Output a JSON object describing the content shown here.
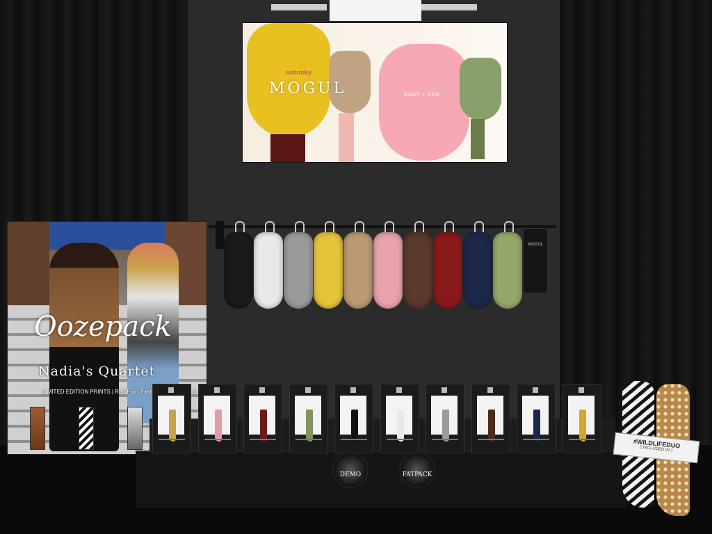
{
  "poster": {
    "tag": "saturday",
    "logo": "MOGUL",
    "subtitle": "NAUT + DRA"
  },
  "sign": {
    "brand": "Oozepack",
    "product": "Nadia's Quartet",
    "note": "LIMITED EDITION PRINTS | Red Fox | Fashion Killa | Silver Fox"
  },
  "coats": [
    {
      "color": "#1a1a1a"
    },
    {
      "color": "#e9e9e9"
    },
    {
      "color": "#9a9a9a"
    },
    {
      "color": "#e6c43a"
    },
    {
      "color": "#b99a74"
    },
    {
      "color": "#e9a3ad"
    },
    {
      "color": "#5a3a28"
    },
    {
      "color": "#8a1a1a"
    },
    {
      "color": "#1c2848"
    },
    {
      "color": "#93a86a"
    }
  ],
  "garment_bag": {
    "label": "MOGUL"
  },
  "boots": [
    {
      "color": "#c9a24a"
    },
    {
      "color": "#e39aa6"
    },
    {
      "color": "#6a1a1a"
    },
    {
      "color": "#7f9460"
    },
    {
      "color": "#111111"
    },
    {
      "color": "#e9e9e9"
    },
    {
      "color": "#9a9a9a"
    },
    {
      "color": "#4a2a1c"
    },
    {
      "color": "#1c2848"
    },
    {
      "color": "#d4a630"
    }
  ],
  "buttons": {
    "demo": "DEMO",
    "fatpack": "FATPACK"
  },
  "wild_tag": {
    "title": "#WILDLIFEDUO",
    "sub": "2 INCLUDED IN 1"
  }
}
